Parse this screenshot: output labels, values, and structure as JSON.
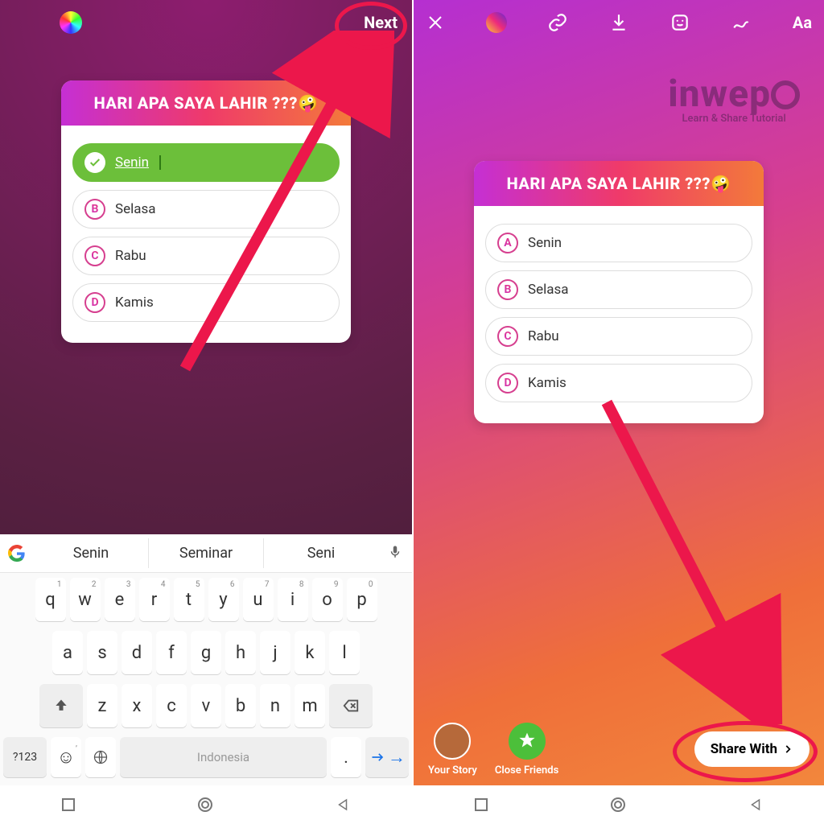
{
  "left": {
    "next_label": "Next",
    "quiz": {
      "title": "HARI APA SAYA LAHIR ???",
      "emoji": "🤪",
      "options": [
        {
          "letter": "✓",
          "label": "Senin",
          "correct": true
        },
        {
          "letter": "B",
          "label": "Selasa"
        },
        {
          "letter": "C",
          "label": "Rabu"
        },
        {
          "letter": "D",
          "label": "Kamis"
        }
      ]
    },
    "keyboard": {
      "suggestions": [
        "Senin",
        "Seminar",
        "Seni"
      ],
      "row1": [
        "q",
        "w",
        "e",
        "r",
        "t",
        "y",
        "u",
        "i",
        "o",
        "p"
      ],
      "row1_nums": [
        "1",
        "2",
        "3",
        "4",
        "5",
        "6",
        "7",
        "8",
        "9",
        "0"
      ],
      "row2": [
        "a",
        "s",
        "d",
        "f",
        "g",
        "h",
        "j",
        "k",
        "l"
      ],
      "row3": [
        "z",
        "x",
        "c",
        "v",
        "b",
        "n",
        "m"
      ],
      "symkey": "?123",
      "space_label": "Indonesia"
    }
  },
  "right": {
    "watermark_brand": "inwepo",
    "watermark_tag": "Learn & Share Tutorial",
    "quiz": {
      "title": "HARI APA SAYA LAHIR ???",
      "emoji": "🤪",
      "options": [
        {
          "letter": "A",
          "label": "Senin"
        },
        {
          "letter": "B",
          "label": "Selasa"
        },
        {
          "letter": "C",
          "label": "Rabu"
        },
        {
          "letter": "D",
          "label": "Kamis"
        }
      ]
    },
    "share": {
      "your_story": "Your Story",
      "close_friends": "Close Friends",
      "share_with": "Share With"
    },
    "toolbar_text": "Aa"
  },
  "colors": {
    "annotation": "#ec174b",
    "correct_green": "#6cbf3a"
  }
}
